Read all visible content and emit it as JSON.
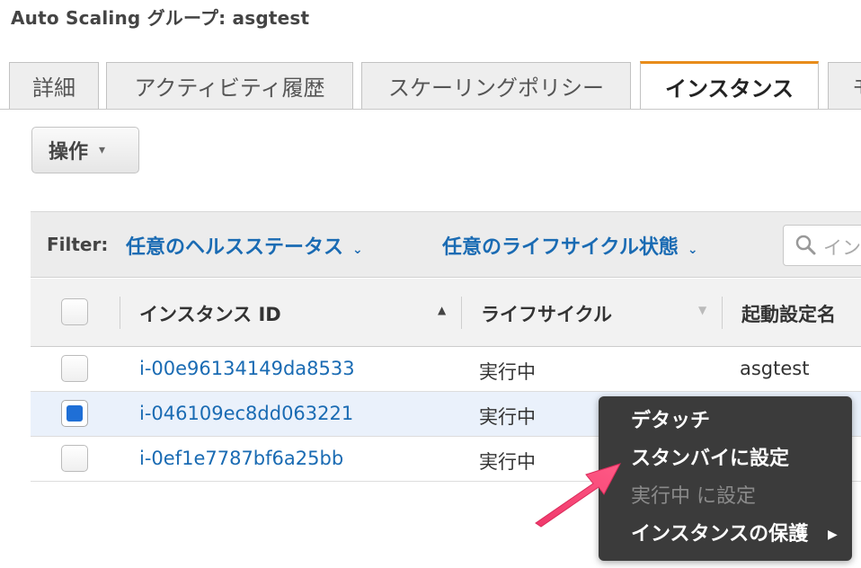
{
  "page": {
    "title": "Auto Scaling グループ: asgtest"
  },
  "tabs": [
    {
      "label": "詳細",
      "active": false
    },
    {
      "label": "アクティビティ履歴",
      "active": false
    },
    {
      "label": "スケーリングポリシー",
      "active": false
    },
    {
      "label": "インスタンス",
      "active": true
    },
    {
      "label": "モ",
      "active": false
    }
  ],
  "toolbar": {
    "actions_label": "操作",
    "caret": "▾"
  },
  "filter": {
    "label": "Filter:",
    "health": "任意のヘルスステータス",
    "lifecycle": "任意のライフサイクル状態",
    "search_placeholder": "イン"
  },
  "table": {
    "columns": [
      "インスタンス ID",
      "ライフサイクル",
      "起動設定名"
    ],
    "rows": [
      {
        "id": "i-00e96134149da8533",
        "lifecycle": "実行中",
        "launch_config": "asgtest",
        "checked": false
      },
      {
        "id": "i-046109ec8dd063221",
        "lifecycle": "実行中",
        "launch_config": "",
        "checked": true
      },
      {
        "id": "i-0ef1e7787bf6a25bb",
        "lifecycle": "実行中",
        "launch_config": "",
        "checked": false
      }
    ]
  },
  "context_menu": {
    "items": [
      {
        "label": "デタッチ",
        "enabled": true
      },
      {
        "label": "スタンバイに設定",
        "enabled": true
      },
      {
        "label": "実行中 に設定",
        "enabled": false
      },
      {
        "label": "インスタンスの保護",
        "enabled": true,
        "submenu": true
      }
    ]
  },
  "colors": {
    "link": "#1a6bb3",
    "accent_tab": "#e88c1a",
    "checkbox": "#1f6fd6",
    "arrow": "#f0386b",
    "menu_bg": "#3b3b3b"
  }
}
